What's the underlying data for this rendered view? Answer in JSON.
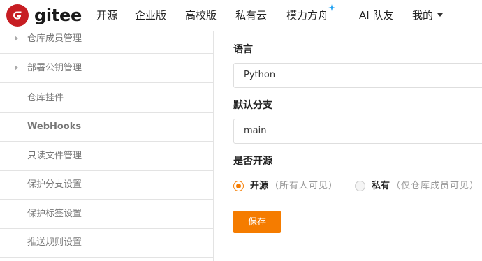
{
  "header": {
    "logo_text": "gitee",
    "nav": [
      {
        "label": "开源"
      },
      {
        "label": "企业版"
      },
      {
        "label": "高校版"
      },
      {
        "label": "私有云"
      },
      {
        "label": "模力方舟"
      },
      {
        "label": "AI 队友"
      },
      {
        "label": "我的"
      }
    ],
    "accent_color": "#c71d23"
  },
  "sidebar": {
    "items": [
      {
        "label": "仓库成员管理",
        "expandable": true
      },
      {
        "label": "部署公钥管理",
        "expandable": true
      },
      {
        "label": "仓库挂件"
      },
      {
        "label": "WebHooks"
      },
      {
        "label": "只读文件管理"
      },
      {
        "label": "保护分支设置"
      },
      {
        "label": "保护标签设置"
      },
      {
        "label": "推送规则设置"
      }
    ]
  },
  "form": {
    "language_label": "语言",
    "language_value": "Python",
    "branch_label": "默认分支",
    "branch_value": "main",
    "visibility_label": "是否开源",
    "visibility_options": [
      {
        "label": "开源",
        "hint": "（所有人可见）",
        "selected": true
      },
      {
        "label": "私有",
        "hint": "（仅仓库成员可见）",
        "selected": false
      }
    ],
    "save_label": "保存",
    "primary_color": "#f57c00"
  }
}
